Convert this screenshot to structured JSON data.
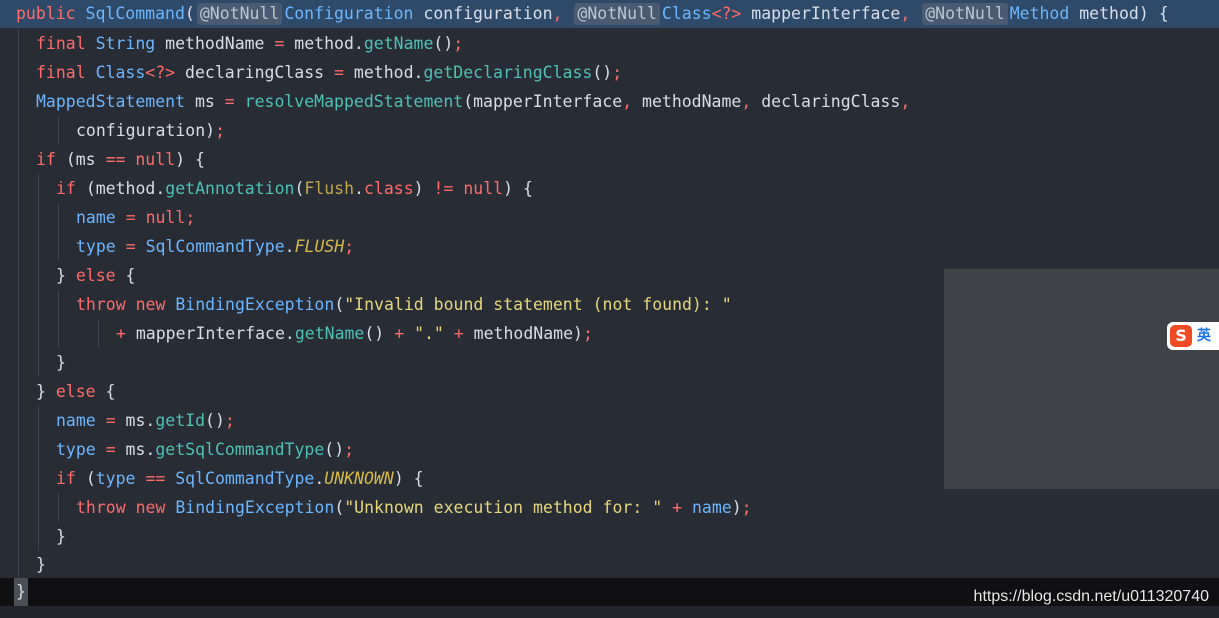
{
  "editor": {
    "lines": [
      [
        [
          "kw",
          "public "
        ],
        [
          "ty",
          "SqlCommand"
        ],
        [
          "pl",
          "("
        ],
        [
          "ann",
          "@NotNull"
        ],
        [
          "ty",
          "Configuration"
        ],
        [
          "pl",
          " configuration"
        ],
        [
          "op",
          ", "
        ],
        [
          "ann",
          "@NotNull"
        ],
        [
          "ty",
          "Class"
        ],
        [
          "op",
          "<?>"
        ],
        [
          "pl",
          " mapperInterface"
        ],
        [
          "op",
          ", "
        ],
        [
          "ann",
          "@NotNull"
        ],
        [
          "ty",
          "Method"
        ],
        [
          "pl",
          " method) {"
        ]
      ],
      [
        [
          "kw",
          "final "
        ],
        [
          "ty",
          "String"
        ],
        [
          "pl",
          " methodName "
        ],
        [
          "op",
          "="
        ],
        [
          "pl",
          " method."
        ],
        [
          "fn",
          "getName"
        ],
        [
          "pl",
          "()"
        ],
        [
          "op",
          ";"
        ]
      ],
      [
        [
          "kw",
          "final "
        ],
        [
          "ty",
          "Class"
        ],
        [
          "op",
          "<?>"
        ],
        [
          "pl",
          " declaringClass "
        ],
        [
          "op",
          "="
        ],
        [
          "pl",
          " method."
        ],
        [
          "fn",
          "getDeclaringClass"
        ],
        [
          "pl",
          "()"
        ],
        [
          "op",
          ";"
        ]
      ],
      [
        [
          "ty",
          "MappedStatement"
        ],
        [
          "pl",
          " ms "
        ],
        [
          "op",
          "="
        ],
        [
          "pl",
          " "
        ],
        [
          "fn",
          "resolveMappedStatement"
        ],
        [
          "pl",
          "(mapperInterface"
        ],
        [
          "op",
          ","
        ],
        [
          "pl",
          " methodName"
        ],
        [
          "op",
          ","
        ],
        [
          "pl",
          " declaringClass"
        ],
        [
          "op",
          ","
        ]
      ],
      [
        [
          "pl",
          "configuration)"
        ],
        [
          "op",
          ";"
        ]
      ],
      [
        [
          "kw",
          "if "
        ],
        [
          "pl",
          "(ms "
        ],
        [
          "op",
          "=="
        ],
        [
          "pl",
          " "
        ],
        [
          "kw",
          "null"
        ],
        [
          "pl",
          ") {"
        ]
      ],
      [
        [
          "kw",
          "if "
        ],
        [
          "pl",
          "(method."
        ],
        [
          "fn",
          "getAnnotation"
        ],
        [
          "pl",
          "("
        ],
        [
          "an",
          "Flush"
        ],
        [
          "pl",
          "."
        ],
        [
          "kw",
          "class"
        ],
        [
          "pl",
          ") "
        ],
        [
          "op",
          "!="
        ],
        [
          "pl",
          " "
        ],
        [
          "kw",
          "null"
        ],
        [
          "pl",
          ") {"
        ]
      ],
      [
        [
          "fld",
          "name"
        ],
        [
          "pl",
          " "
        ],
        [
          "op",
          "="
        ],
        [
          "pl",
          " "
        ],
        [
          "kw",
          "null"
        ],
        [
          "op",
          ";"
        ]
      ],
      [
        [
          "fld",
          "type"
        ],
        [
          "pl",
          " "
        ],
        [
          "op",
          "="
        ],
        [
          "pl",
          " "
        ],
        [
          "ty",
          "SqlCommandType"
        ],
        [
          "pl",
          "."
        ],
        [
          "cn",
          "FLUSH"
        ],
        [
          "op",
          ";"
        ]
      ],
      [
        [
          "pl",
          "} "
        ],
        [
          "kw",
          "else "
        ],
        [
          "pl",
          "{"
        ]
      ],
      [
        [
          "kw",
          "throw "
        ],
        [
          "kw",
          "new "
        ],
        [
          "ty",
          "BindingException"
        ],
        [
          "pl",
          "("
        ],
        [
          "str",
          "\"Invalid bound statement (not found): \""
        ]
      ],
      [
        [
          "op",
          "+ "
        ],
        [
          "pl",
          "mapperInterface."
        ],
        [
          "fn",
          "getName"
        ],
        [
          "pl",
          "() "
        ],
        [
          "op",
          "+"
        ],
        [
          "pl",
          " "
        ],
        [
          "str",
          "\".\""
        ],
        [
          "pl",
          " "
        ],
        [
          "op",
          "+"
        ],
        [
          "pl",
          " methodName)"
        ],
        [
          "op",
          ";"
        ]
      ],
      [
        [
          "pl",
          "}"
        ]
      ],
      [
        [
          "pl",
          "} "
        ],
        [
          "kw",
          "else "
        ],
        [
          "pl",
          "{"
        ]
      ],
      [
        [
          "fld",
          "name"
        ],
        [
          "pl",
          " "
        ],
        [
          "op",
          "="
        ],
        [
          "pl",
          " ms."
        ],
        [
          "fn",
          "getId"
        ],
        [
          "pl",
          "()"
        ],
        [
          "op",
          ";"
        ]
      ],
      [
        [
          "fld",
          "type"
        ],
        [
          "pl",
          " "
        ],
        [
          "op",
          "="
        ],
        [
          "pl",
          " ms."
        ],
        [
          "fn",
          "getSqlCommandType"
        ],
        [
          "pl",
          "()"
        ],
        [
          "op",
          ";"
        ]
      ],
      [
        [
          "kw",
          "if "
        ],
        [
          "pl",
          "("
        ],
        [
          "fld",
          "type"
        ],
        [
          "pl",
          " "
        ],
        [
          "op",
          "=="
        ],
        [
          "pl",
          " "
        ],
        [
          "ty",
          "SqlCommandType"
        ],
        [
          "pl",
          "."
        ],
        [
          "cn",
          "UNKNOWN"
        ],
        [
          "pl",
          ") {"
        ]
      ],
      [
        [
          "kw",
          "throw "
        ],
        [
          "kw",
          "new "
        ],
        [
          "ty",
          "BindingException"
        ],
        [
          "pl",
          "("
        ],
        [
          "str",
          "\"Unknown execution method for: \""
        ],
        [
          "pl",
          " "
        ],
        [
          "op",
          "+"
        ],
        [
          "pl",
          " "
        ],
        [
          "fld",
          "name"
        ],
        [
          "pl",
          ")"
        ],
        [
          "op",
          ";"
        ]
      ],
      [
        [
          "pl",
          "}"
        ]
      ],
      [
        [
          "pl",
          "}"
        ]
      ]
    ],
    "closing_brace": "}"
  },
  "ime": {
    "logo": "S",
    "mode": "英"
  },
  "watermark": "https://blog.csdn.net/u011320740"
}
